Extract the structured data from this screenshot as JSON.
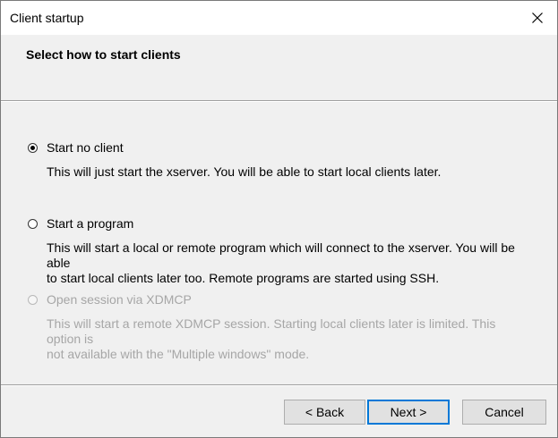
{
  "window": {
    "title": "Client startup"
  },
  "header": {
    "heading": "Select how to start clients"
  },
  "options": [
    {
      "label": "Start no client",
      "description": "This will just start the xserver. You will be able to start local clients later.",
      "checked": true,
      "enabled": true
    },
    {
      "label": "Start a program",
      "description_line1": "This will start a local or remote program which will connect to the xserver. You will be able",
      "description_line2": "to start local clients later too. Remote programs are started using SSH.",
      "checked": false,
      "enabled": true
    },
    {
      "label": "Open session via XDMCP",
      "description_line1": "This will start a remote XDMCP session. Starting local clients later is limited. This option is",
      "description_line2": "not available with the \"Multiple windows\" mode.",
      "checked": false,
      "enabled": false
    }
  ],
  "buttons": {
    "back": "< Back",
    "next": "Next >",
    "cancel": "Cancel"
  },
  "colors": {
    "accent": "#0078d7",
    "disabled_text": "#a6a6a6"
  }
}
